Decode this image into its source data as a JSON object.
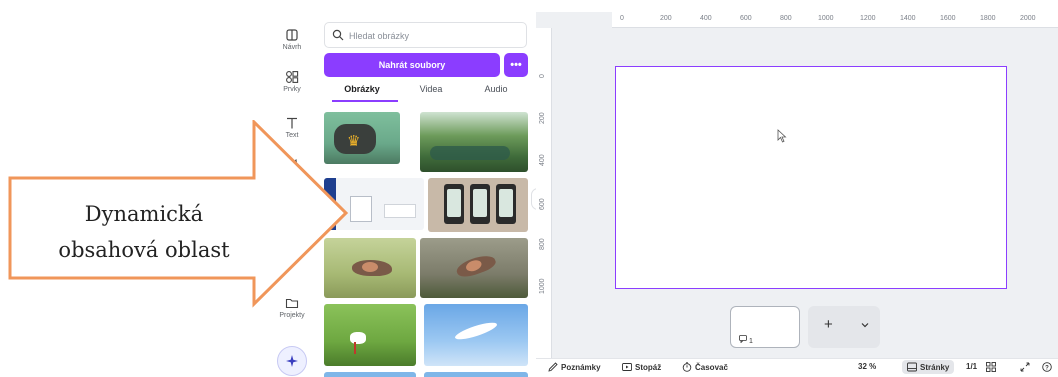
{
  "rail": {
    "items": [
      {
        "label": "Návrh",
        "icon": "design-icon"
      },
      {
        "label": "Prvky",
        "icon": "elements-icon"
      },
      {
        "label": "Text",
        "icon": "text-icon"
      },
      {
        "label": "",
        "icon": "brand-icon"
      },
      {
        "label": "Projekty",
        "icon": "folder-icon"
      }
    ],
    "magic_icon": "sparkle-icon"
  },
  "panel": {
    "search_placeholder": "Hledat obrázky",
    "upload_label": "Nahrát soubory",
    "more_label": "•••",
    "tabs": [
      "Obrázky",
      "Videa",
      "Audio"
    ],
    "active_tab": "Obrázky",
    "collapse_label": "‹"
  },
  "ruler": {
    "top": [
      "0",
      "200",
      "400",
      "600",
      "800",
      "1000",
      "1200",
      "1400",
      "1600",
      "1800",
      "2000"
    ],
    "left": [
      "0",
      "200",
      "400",
      "600",
      "800",
      "1000"
    ]
  },
  "pages": {
    "thumb_number": "1",
    "add_label": "+"
  },
  "bottom_bar": {
    "notes": "Poznámky",
    "duration": "Stopáž",
    "timer": "Časovač",
    "zoom": "32 %",
    "pages": "Stránky",
    "page_count": "1/1"
  },
  "annotation": {
    "line1": "Dynamická",
    "line2": "obsahová oblast",
    "arrow_color": "#f0965a"
  },
  "colors": {
    "accent": "#8b3dff"
  }
}
